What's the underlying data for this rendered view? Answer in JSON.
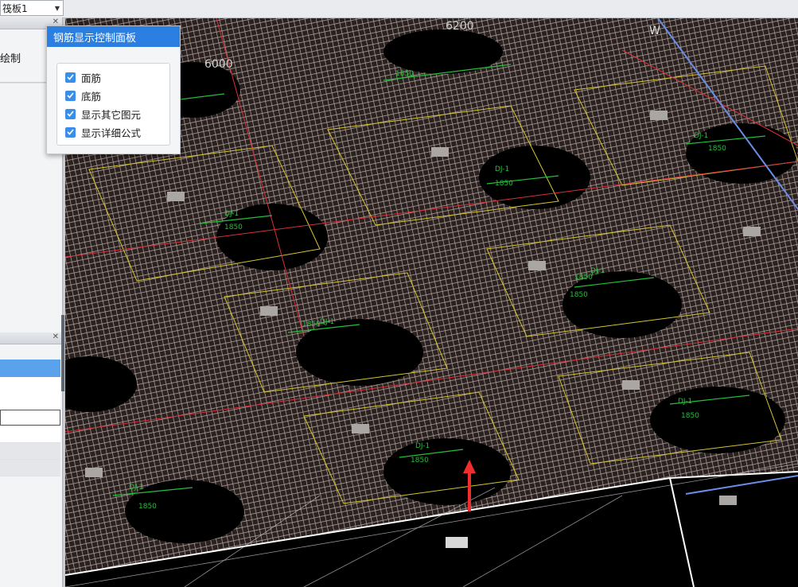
{
  "toolbar": {
    "floor_select_value": "筏板1"
  },
  "left_panel": {
    "draw_button_label": "绘制"
  },
  "rebar_panel": {
    "title": "钢筋显示控制面板",
    "options": [
      {
        "label": "面筋",
        "checked": true
      },
      {
        "label": "底筋",
        "checked": true
      },
      {
        "label": "显示其它图元",
        "checked": true
      },
      {
        "label": "显示详细公式",
        "checked": true
      }
    ]
  },
  "viewport": {
    "dimension_labels": [
      "6200",
      "6000",
      "1850",
      "1850",
      "1850",
      "1850",
      "1850",
      "1850",
      "1850",
      "1850",
      "1850",
      "1850"
    ],
    "pad_labels": [
      "DJ-1",
      "DJ-1",
      "DJ-1",
      "DJ-1",
      "DJ-1",
      "DJ-1",
      "DJ-1",
      "DJ-1"
    ],
    "axis_labels": [
      "W"
    ],
    "colors": {
      "mesh": "#b8a6a0",
      "pad_outline": "#d6c630",
      "dimension": "#22c03a",
      "axis_red": "#d9303a",
      "axis_blue": "#6b8de8",
      "arrow": "#f02c2c"
    }
  }
}
